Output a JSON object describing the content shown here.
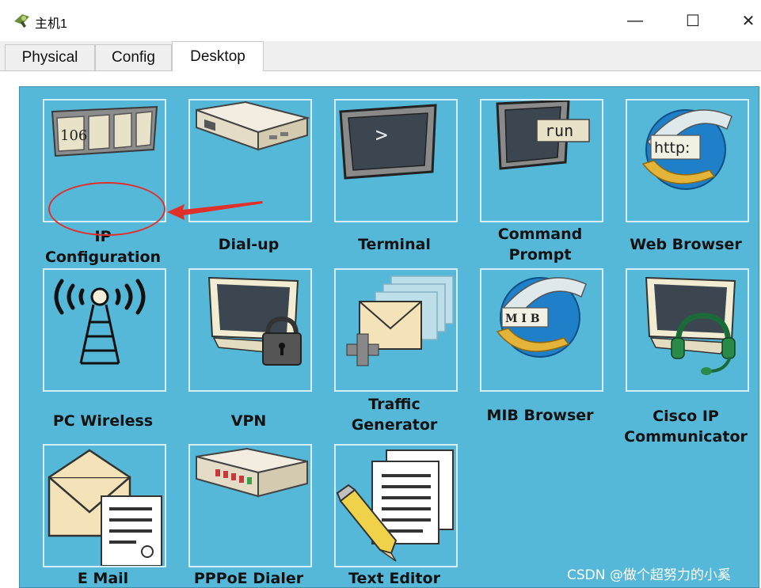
{
  "window": {
    "title": "主机1",
    "icon": "pc-host-icon",
    "minimize": "—",
    "maximize": "☐",
    "close": "✕"
  },
  "tabs": [
    {
      "label": "Physical"
    },
    {
      "label": "Config"
    },
    {
      "label": "Desktop"
    }
  ],
  "active_tab": "Desktop",
  "apps": [
    {
      "lines": [
        "IP",
        "Configuration"
      ],
      "icon": "ip-configuration-icon",
      "icon_text": "106"
    },
    {
      "lines": [
        "Dial-up"
      ],
      "icon": "modem-icon"
    },
    {
      "lines": [
        "Terminal"
      ],
      "icon": "terminal-icon",
      "icon_text": ">"
    },
    {
      "lines": [
        "Command",
        "Prompt"
      ],
      "icon": "command-prompt-icon",
      "icon_text": "run"
    },
    {
      "lines": [
        "Web Browser"
      ],
      "icon": "web-browser-icon",
      "icon_text": "http:"
    },
    {
      "lines": [
        "PC Wireless"
      ],
      "icon": "wireless-tower-icon"
    },
    {
      "lines": [
        "VPN"
      ],
      "icon": "vpn-lock-icon"
    },
    {
      "lines": [
        "Traffic",
        "Generator"
      ],
      "icon": "traffic-generator-icon"
    },
    {
      "lines": [
        "MIB Browser"
      ],
      "icon": "mib-browser-icon",
      "icon_text": "M I B"
    },
    {
      "lines": [
        "Cisco IP",
        "Communicator"
      ],
      "icon": "ip-communicator-headset-icon"
    },
    {
      "lines": [
        "E Mail"
      ],
      "icon": "email-icon"
    },
    {
      "lines": [
        "PPPoE Dialer"
      ],
      "icon": "pppoe-dialer-icon"
    },
    {
      "lines": [
        "Text Editor"
      ],
      "icon": "text-editor-icon"
    }
  ],
  "watermark": "CSDN @做个超努力的小奚",
  "colors": {
    "desktop_bg": "#55b8d8",
    "annotation": "#e0302c"
  }
}
